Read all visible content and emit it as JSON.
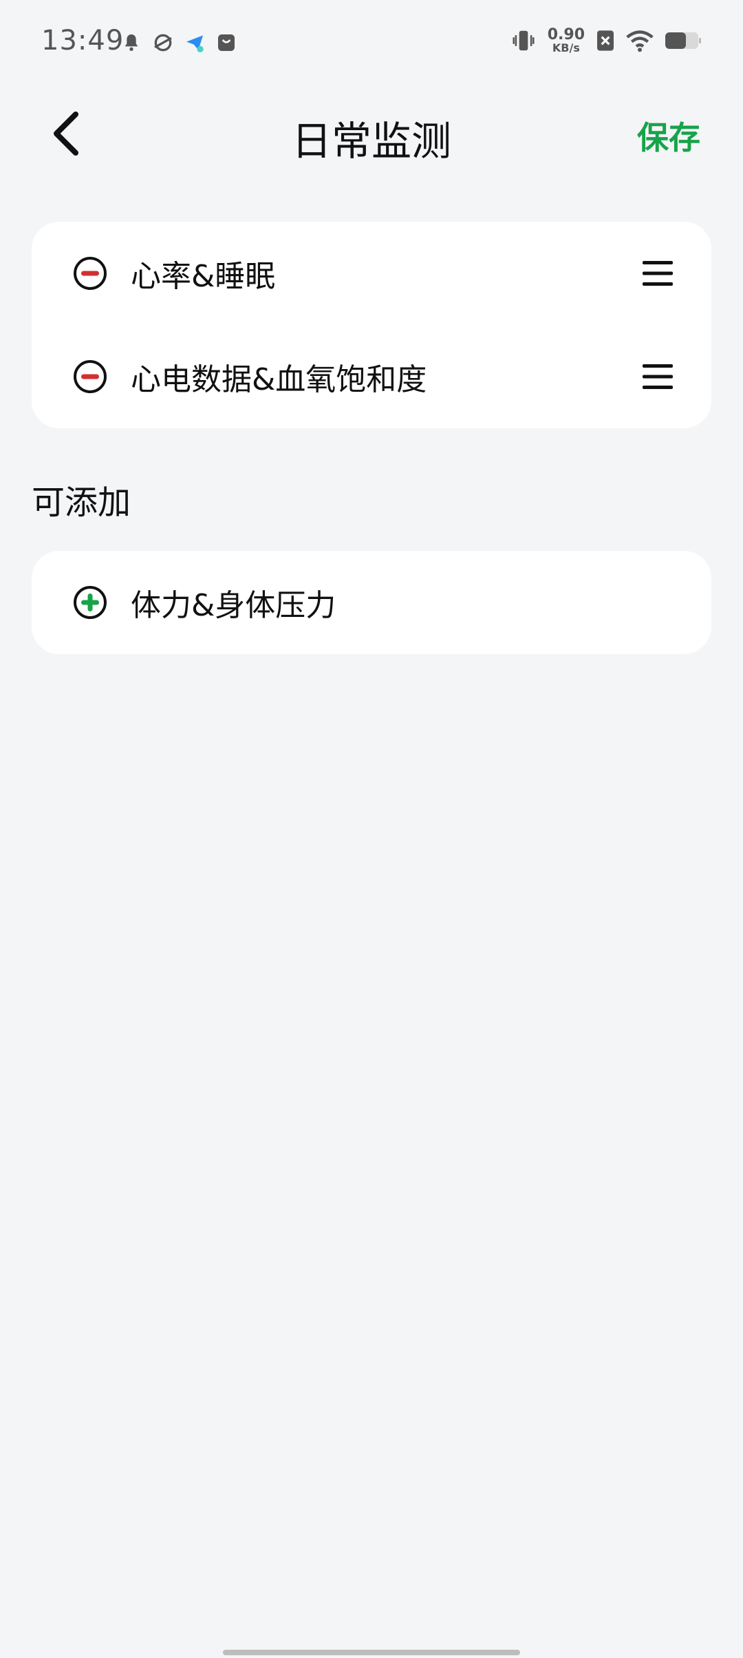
{
  "status_bar": {
    "time": "13:49",
    "left_icons": [
      "bell-icon",
      "app-orbit-icon",
      "telegram-icon",
      "shopping-bag-icon"
    ],
    "net_speed_value": "0.90",
    "net_speed_unit": "KB/s",
    "right_icons": [
      "vibrate-icon",
      "sim-off-icon",
      "wifi-icon",
      "battery-icon"
    ]
  },
  "header": {
    "title": "日常监测",
    "save_label": "保存",
    "back_icon": "chevron-left-icon"
  },
  "active_items": [
    {
      "label": "心率&睡眠",
      "icon": "remove-circle-icon"
    },
    {
      "label": "心电数据&血氧饱和度",
      "icon": "remove-circle-icon"
    }
  ],
  "addable_section": {
    "title": "可添加",
    "items": [
      {
        "label": "体力&身体压力",
        "icon": "add-circle-icon"
      }
    ]
  },
  "colors": {
    "background": "#f4f5f7",
    "card": "#ffffff",
    "accent_green": "#17a34a",
    "remove_red": "#d32f2f"
  }
}
